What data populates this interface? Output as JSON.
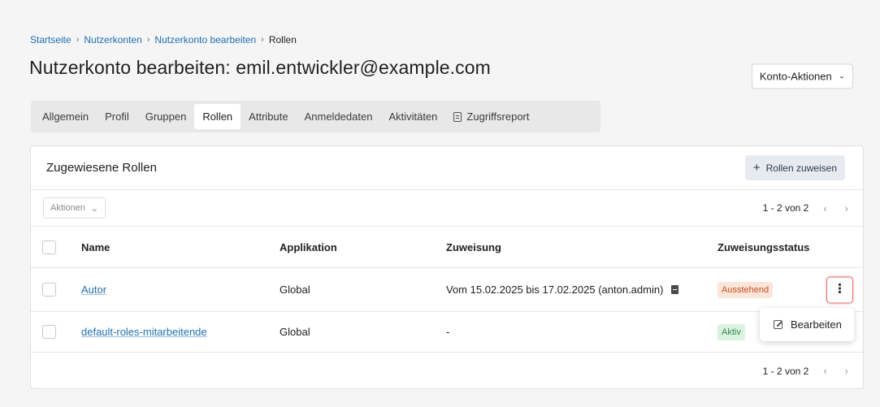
{
  "breadcrumb": {
    "items": [
      "Startseite",
      "Nutzerkonten",
      "Nutzerkonto bearbeiten"
    ],
    "current": "Rollen",
    "separator": "›"
  },
  "page_title": "Nutzerkonto bearbeiten: emil.entwickler@example.com",
  "account_actions": {
    "label": "Konto-Aktionen",
    "icon": "chevron-down-icon"
  },
  "tabs": [
    {
      "label": "Allgemein"
    },
    {
      "label": "Profil"
    },
    {
      "label": "Gruppen"
    },
    {
      "label": "Rollen",
      "active": true
    },
    {
      "label": "Attribute"
    },
    {
      "label": "Anmeldedaten"
    },
    {
      "label": "Aktivitäten"
    },
    {
      "label": "Zugriffsreport",
      "icon": "report-icon"
    }
  ],
  "card": {
    "title": "Zugewiesene Rollen",
    "assign_button": "Rollen zuweisen",
    "actions_dropdown": "Aktionen",
    "pagination": "1 - 2 von 2",
    "columns": {
      "name": "Name",
      "app": "Applikation",
      "assignment": "Zuweisung",
      "status": "Zuweisungsstatus"
    },
    "rows": [
      {
        "name": "Autor",
        "app": "Global",
        "assignment": "Vom 15.02.2025 bis 17.02.2025 (anton.admin)",
        "status": "Ausstehend"
      },
      {
        "name": "default-roles-mitarbeitende",
        "app": "Global",
        "assignment": "-",
        "status": "Aktiv"
      }
    ]
  },
  "context_menu": {
    "edit_label": "Bearbeiten"
  },
  "colors": {
    "link": "#1f6fb0",
    "pending_bg": "#fbe6dc",
    "pending_text": "#c84f1c",
    "active_bg": "#dcf2e0",
    "active_text": "#2d8a44",
    "focus_ring": "#e26868"
  }
}
